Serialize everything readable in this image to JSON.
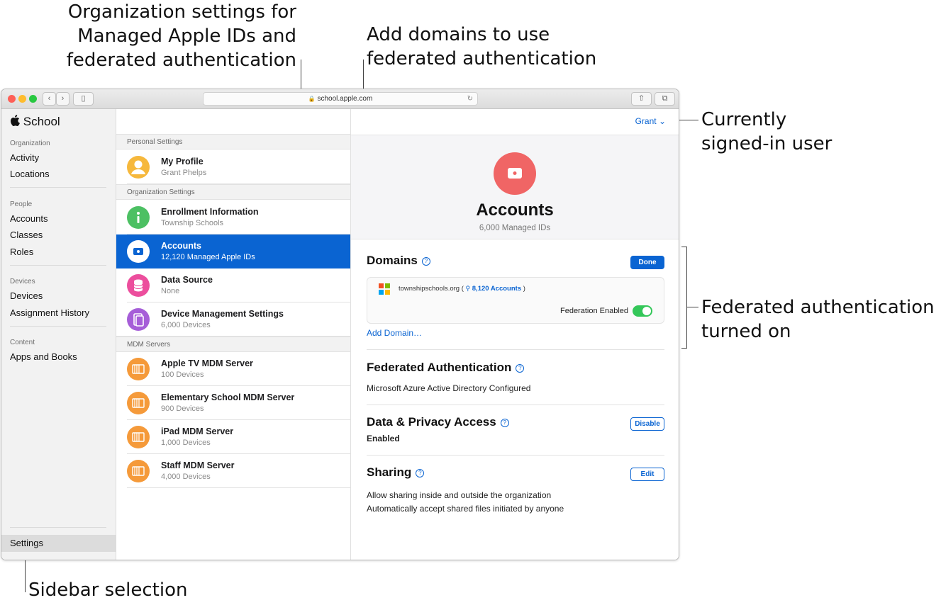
{
  "callouts": {
    "org_settings": [
      "Organization settings for",
      "Managed Apple IDs and",
      "federated authentication"
    ],
    "add_domains": [
      "Add domains to use",
      "federated authentication"
    ],
    "signed_in_user": [
      "Currently",
      "signed-in user"
    ],
    "federated_on": [
      "Federated authentication",
      "turned on"
    ],
    "sidebar_selection": "Sidebar selection"
  },
  "browser": {
    "url": "school.apple.com",
    "back_label": "‹",
    "forward_label": "›",
    "sidebar_toggle_label": "▯",
    "share_label": "⇧",
    "tabs_label": "⧉",
    "reload_label": "↻"
  },
  "sidebar": {
    "brand": "School",
    "sections": [
      {
        "heading": "Organization",
        "items": [
          "Activity",
          "Locations"
        ]
      },
      {
        "heading": "People",
        "items": [
          "Accounts",
          "Classes",
          "Roles"
        ]
      },
      {
        "heading": "Devices",
        "items": [
          "Devices",
          "Assignment History"
        ]
      },
      {
        "heading": "Content",
        "items": [
          "Apps and Books"
        ]
      }
    ],
    "settings_label": "Settings"
  },
  "list": {
    "personal_heading": "Personal Settings",
    "org_heading": "Organization Settings",
    "mdm_heading": "MDM Servers",
    "rows": [
      {
        "title": "My Profile",
        "subtitle": "Grant Phelps",
        "icon": "person-icon"
      },
      {
        "title": "Enrollment Information",
        "subtitle": "Township Schools",
        "icon": "info-icon"
      },
      {
        "title": "Accounts",
        "subtitle": "12,120 Managed Apple IDs",
        "icon": "apple-id-icon",
        "selected": true
      },
      {
        "title": "Data Source",
        "subtitle": "None",
        "icon": "database-icon"
      },
      {
        "title": "Device Management Settings",
        "subtitle": " 6,000 Devices",
        "icon": "devices-icon"
      },
      {
        "title": "Apple TV MDM Server",
        "subtitle": "100 Devices",
        "icon": "server-icon"
      },
      {
        "title": "Elementary School MDM Server",
        "subtitle": "900 Devices",
        "icon": "server-icon"
      },
      {
        "title": "iPad MDM Server",
        "subtitle": "1,000 Devices",
        "icon": "server-icon"
      },
      {
        "title": "Staff MDM Server",
        "subtitle": "4,000 Devices",
        "icon": "server-icon"
      }
    ]
  },
  "detail": {
    "user_menu": "Grant ⌄",
    "title": "Accounts",
    "subtitle": "6,000 Managed IDs",
    "domains": {
      "heading": "Domains",
      "done_label": "Done",
      "domain": "townshipschools.org (",
      "accounts_link": "8,120 Accounts",
      "domain_close": ")",
      "federation_label": "Federation Enabled",
      "federation_on": true,
      "add_domain": "Add Domain…"
    },
    "federated": {
      "heading": "Federated Authentication",
      "status": "Microsoft Azure Active Directory Configured"
    },
    "privacy": {
      "heading": "Data & Privacy Access",
      "status": "Enabled",
      "button": "Disable"
    },
    "sharing": {
      "heading": "Sharing",
      "button": "Edit",
      "line1": "Allow sharing inside and outside the organization",
      "line2": "Automatically accept shared files initiated by anyone"
    }
  },
  "colors": {
    "accent": "#0a64d2",
    "selection": "#0a64d2",
    "toggle_on": "#34c759",
    "accounts_icon": "#f06565"
  }
}
